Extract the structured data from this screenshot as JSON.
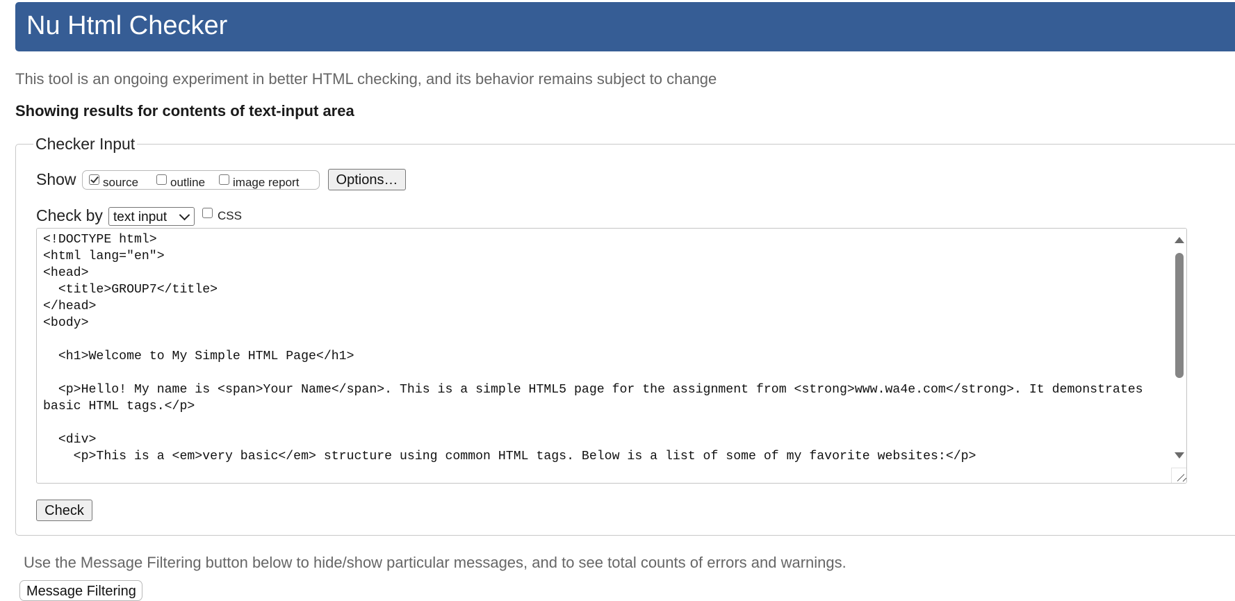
{
  "header": {
    "title": "Nu Html Checker"
  },
  "subtitle": "This tool is an ongoing experiment in better HTML checking, and its behavior remains subject to change",
  "results_heading": "Showing results for contents of text-input area",
  "checker": {
    "legend": "Checker Input",
    "show_label": "Show",
    "show_options": [
      {
        "label": "source",
        "checked": true
      },
      {
        "label": "outline",
        "checked": false
      },
      {
        "label": "image report",
        "checked": false
      }
    ],
    "options_button": "Options…",
    "check_by_label": "Check by",
    "check_by_select": {
      "value": "text input"
    },
    "css_option": {
      "label": "CSS",
      "checked": false
    },
    "source_text": "<!DOCTYPE html>\n<html lang=\"en\">\n<head>\n  <title>GROUP7</title>\n</head>\n<body>\n\n  <h1>Welcome to My Simple HTML Page</h1>\n\n  <p>Hello! My name is <span>Your Name</span>. This is a simple HTML5 page for the assignment from <strong>www.wa4e.com</strong>. It demonstrates basic HTML tags.</p>\n\n  <div>\n    <p>This is a <em>very basic</em> structure using common HTML tags. Below is a list of some of my favorite websites:</p>",
    "check_button": "Check"
  },
  "filter_note": "Use the Message Filtering button below to hide/show particular messages, and to see total counts of errors and warnings.",
  "filter_button": "Message Filtering"
}
